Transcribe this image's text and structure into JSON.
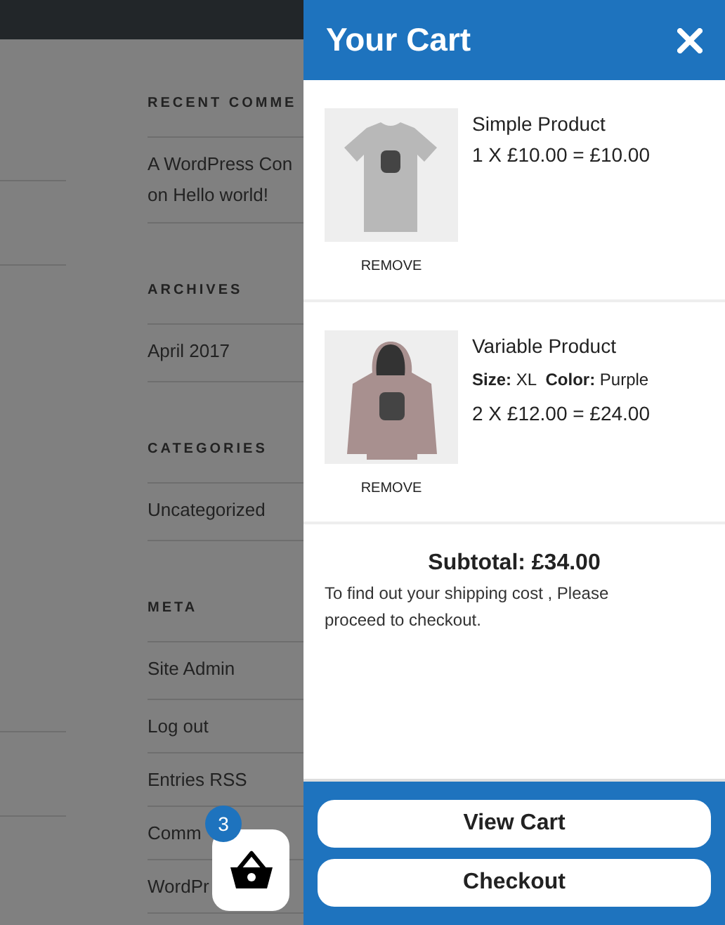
{
  "background_page": {
    "widgets": [
      {
        "heading": "RECENT COMME",
        "items": [
          "A WordPress Con\non Hello world!"
        ]
      },
      {
        "heading": "ARCHIVES",
        "items": [
          "April 2017"
        ]
      },
      {
        "heading": "CATEGORIES",
        "items": [
          "Uncategorized"
        ]
      },
      {
        "heading": "META",
        "items": [
          "Site Admin",
          "Log out",
          "Entries RSS",
          "Comm",
          "WordPr"
        ]
      }
    ]
  },
  "cart": {
    "title": "Your Cart",
    "items": [
      {
        "kind": "tshirt",
        "name": "Simple Product",
        "price_line": "1 X £10.00 = £10.00",
        "remove_label": "REMOVE"
      },
      {
        "kind": "hoodie",
        "name": "Variable Product",
        "attributes": "**Size:** XL  **Color:** Purple",
        "price_line": "2 X £12.00 = £24.00",
        "remove_label": "REMOVE"
      }
    ],
    "subtotal": "Subtotal: £34.00",
    "shipping_note": "To find out your shipping cost , Please proceed to checkout.",
    "buttons": [
      "View Cart",
      "Checkout"
    ]
  },
  "cart_button": {
    "count": "3"
  }
}
